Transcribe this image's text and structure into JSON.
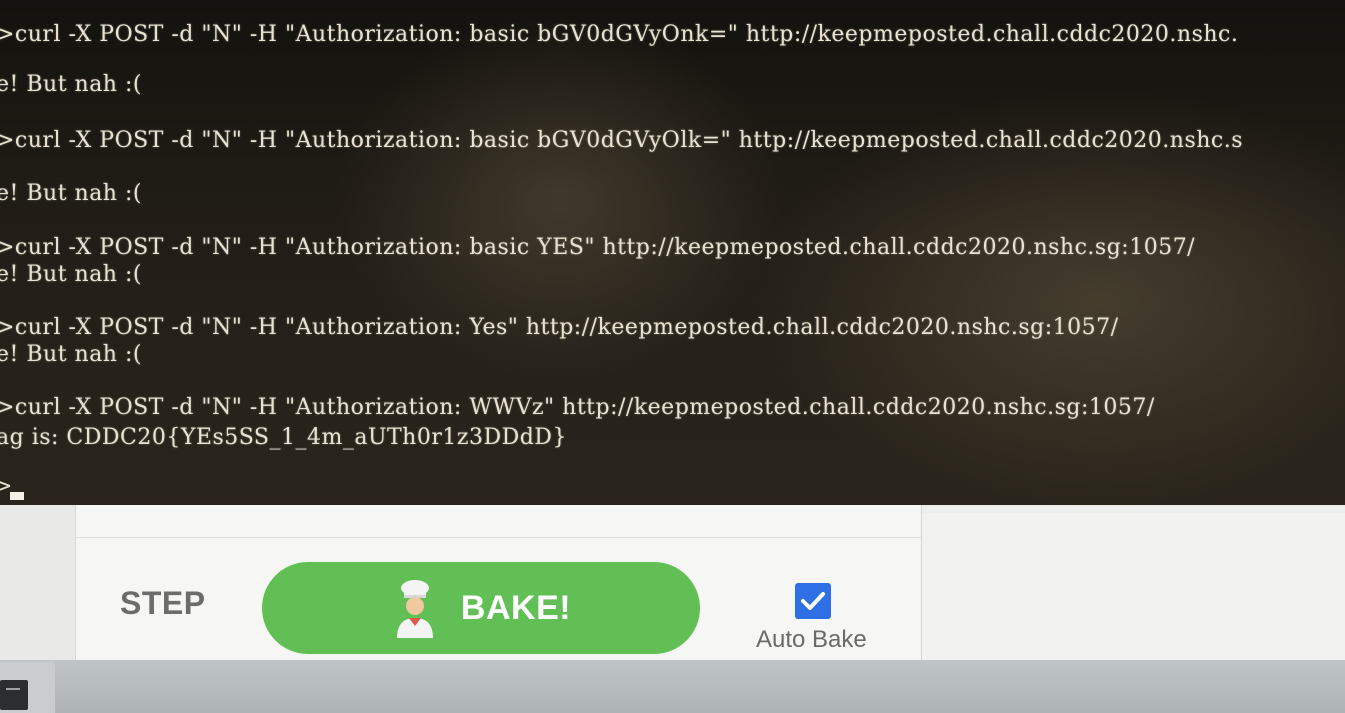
{
  "terminal": {
    "lines": [
      ">curl -X POST -d \"N\" -H \"Authorization: basic bGV0dGVyOnk=\" http://keepmeposted.chall.cddc2020.nshc.",
      "e! But nah :(",
      ">curl -X POST -d \"N\" -H \"Authorization: basic bGV0dGVyOlk=\" http://keepmeposted.chall.cddc2020.nshc.s",
      "e! But nah :(",
      ">curl -X POST -d \"N\" -H \"Authorization: basic YES\" http://keepmeposted.chall.cddc2020.nshc.sg:1057/",
      "e! But nah :(",
      ">curl -X POST -d \"N\" -H \"Authorization: Yes\" http://keepmeposted.chall.cddc2020.nshc.sg:1057/",
      "e! But nah :(",
      ">curl -X POST -d \"N\" -H \"Authorization: WWVz\" http://keepmeposted.chall.cddc2020.nshc.sg:1057/",
      "ag is: CDDC20{YEs5SS_1_4m_aUTh0r1z3DDdD}"
    ],
    "prompt": ">"
  },
  "toolbar": {
    "step_label": "STEP",
    "bake_label": "BAKE!",
    "auto_bake_label": "Auto Bake",
    "auto_bake_checked": true
  },
  "icons": {
    "bake": "chef-icon",
    "auto_bake": "checkbox-checked-icon"
  },
  "colors": {
    "bake_button": "#62bf55",
    "checkbox": "#2f6fe6",
    "terminal_text": "#e8e2d2"
  }
}
